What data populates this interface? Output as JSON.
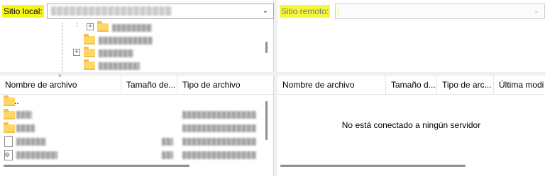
{
  "local": {
    "site_label": "Sitio local:",
    "tree_items": [
      "migracion",
      "Documentos",
      "Descargas",
      "Escritorio"
    ],
    "columns": [
      "Nombre de archivo",
      "Tamaño de...",
      "Tipo de archivo"
    ],
    "parent_entry": "..",
    "files": [
      {
        "kind": "folder"
      },
      {
        "kind": "folder"
      },
      {
        "kind": "folder"
      },
      {
        "kind": "file",
        "size": "395"
      },
      {
        "kind": "file-gear",
        "size": "4KB"
      }
    ]
  },
  "remote": {
    "site_label": "Sitio remoto:",
    "columns": [
      "Nombre de archivo",
      "Tamaño d...",
      "Tipo de arc...",
      "Última modi"
    ],
    "empty_message": "No está conectado a ningún servidor"
  },
  "icons": {
    "folder": "folder-icon",
    "file": "file-icon",
    "dropdown": "chevron-down-icon",
    "expand": "plus-box-icon"
  },
  "colors": {
    "highlight": "#f6f61a",
    "folder": "#ffd766"
  }
}
